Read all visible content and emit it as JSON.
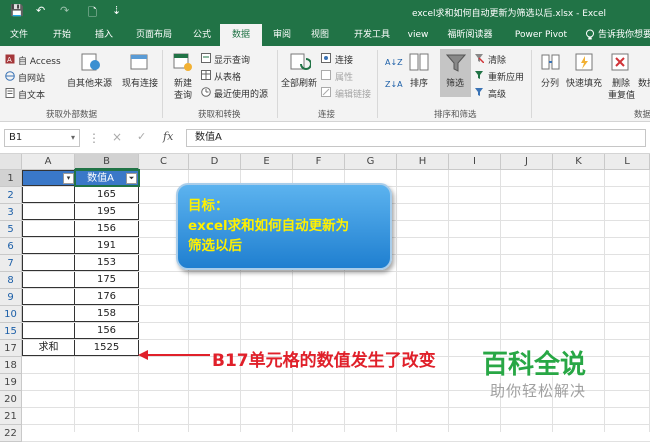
{
  "window": {
    "title": "excel求和如何自动更新为筛选以后.xlsx  -  Excel",
    "qa_save": "💾",
    "qa_undo": "↶",
    "qa_redo": "↷",
    "qa_preview": "🗋",
    "qa_customize": "⇣"
  },
  "tabs": [
    "文件",
    "开始",
    "插入",
    "页面布局",
    "公式",
    "数据",
    "审阅",
    "视图",
    "开发工具",
    "view",
    "福昕阅读器",
    "Power Pivot",
    "告诉我你想要"
  ],
  "ribbon": {
    "ext_access": "自 Access",
    "ext_web": "自网站",
    "ext_text": "自文本",
    "ext_other": "自其他来源",
    "existing": "现有连接",
    "group_external": "获取外部数据",
    "new_query_1": "新建",
    "new_query_2": "查询",
    "show_queries": "显示查询",
    "from_table": "从表格",
    "recent_sources": "最近使用的源",
    "group_transform": "获取和转换",
    "refresh_all": "全部刷新",
    "connections": "连接",
    "properties": "属性",
    "edit_links": "编辑链接",
    "group_connections": "连接",
    "sort_az": "A↓Z",
    "sort_za": "Z↓A",
    "sort": "排序",
    "filter": "筛选",
    "clear": "清除",
    "reapply": "重新应用",
    "advanced": "高级",
    "group_sort_filter": "排序和筛选",
    "text_to_columns": "分列",
    "flash_fill": "快速填充",
    "remove_dup_1": "删除",
    "remove_dup_2": "重复值",
    "validation": "数据",
    "group_tools": "数据"
  },
  "formula_bar": {
    "name_box": "B1",
    "fx": "fx",
    "cancel": "×",
    "enter": "✓",
    "content": "数值A"
  },
  "columns": [
    "A",
    "B",
    "C",
    "D",
    "E",
    "F",
    "G",
    "H",
    "I",
    "J",
    "K",
    "L"
  ],
  "rows": [
    {
      "num": "1",
      "a": "",
      "b": "数值A"
    },
    {
      "num": "2",
      "a": "",
      "b": "165"
    },
    {
      "num": "3",
      "a": "",
      "b": "195"
    },
    {
      "num": "5",
      "a": "",
      "b": "156"
    },
    {
      "num": "6",
      "a": "",
      "b": "191"
    },
    {
      "num": "7",
      "a": "",
      "b": "153"
    },
    {
      "num": "8",
      "a": "",
      "b": "175"
    },
    {
      "num": "9",
      "a": "",
      "b": "176"
    },
    {
      "num": "10",
      "a": "",
      "b": "158"
    },
    {
      "num": "15",
      "a": "",
      "b": "156"
    },
    {
      "num": "17",
      "a": "求和",
      "b": "1525"
    },
    {
      "num": "18",
      "a": "",
      "b": ""
    },
    {
      "num": "19",
      "a": "",
      "b": ""
    },
    {
      "num": "20",
      "a": "",
      "b": ""
    },
    {
      "num": "21",
      "a": "",
      "b": ""
    },
    {
      "num": "22",
      "a": "",
      "b": ""
    }
  ],
  "callout": {
    "line1": "目标：",
    "line2": "excel求和如何自动更新为",
    "line3": "筛选以后"
  },
  "annotation": "B17单元格的数值发生了改变",
  "watermark": {
    "brand": "百科全说",
    "slogan": "助你轻松解决"
  },
  "colors": {
    "excel_green": "#217346",
    "callout_text": "#fff000",
    "annotation_red": "#e0202a",
    "filtered_row_blue": "#1c5fa8",
    "watermark_green": "#28a745"
  }
}
